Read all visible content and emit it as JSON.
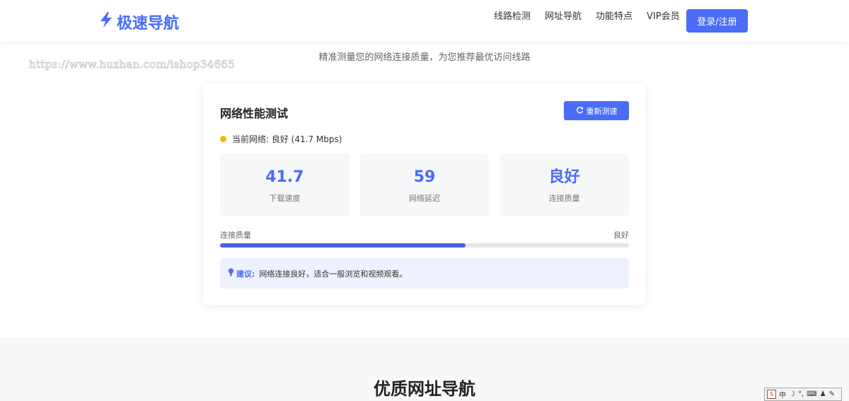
{
  "header": {
    "logo_text": "极速导航",
    "logo_icon": "bolt-icon",
    "nav": [
      "线路检测",
      "网址导航",
      "功能特点",
      "VIP会员"
    ],
    "login_label": "登录/注册"
  },
  "subtitle": "精准测量您的网络连接质量，为您推荐最优访问线路",
  "watermark": "https://www.huzhan.com/ishop34665",
  "test": {
    "title": "网络性能测试",
    "retest_label": "重新测速",
    "retest_icon": "refresh-icon",
    "status_text": "当前网络: 良好 (41.7 Mbps)",
    "status_color": "#f5b800",
    "stats": [
      {
        "value": "41.7",
        "label": "下载速度"
      },
      {
        "value": "59",
        "label": "网络延迟"
      },
      {
        "value": "良好",
        "label": "连接质量"
      }
    ],
    "quality_label": "连接质量",
    "quality_value": "良好",
    "quality_percent": 60,
    "tip_icon": "lightbulb-icon",
    "tip_label": "建议:",
    "tip_text": "网络连接良好，适合一般浏览和视频观看。"
  },
  "section2": {
    "title": "优质网址导航"
  },
  "ime": {
    "items": [
      "中",
      "☽",
      "°,",
      "⌨",
      "♟",
      "✎"
    ]
  },
  "colors": {
    "accent": "#4a6cf7",
    "progress": "#4a5fe0"
  }
}
